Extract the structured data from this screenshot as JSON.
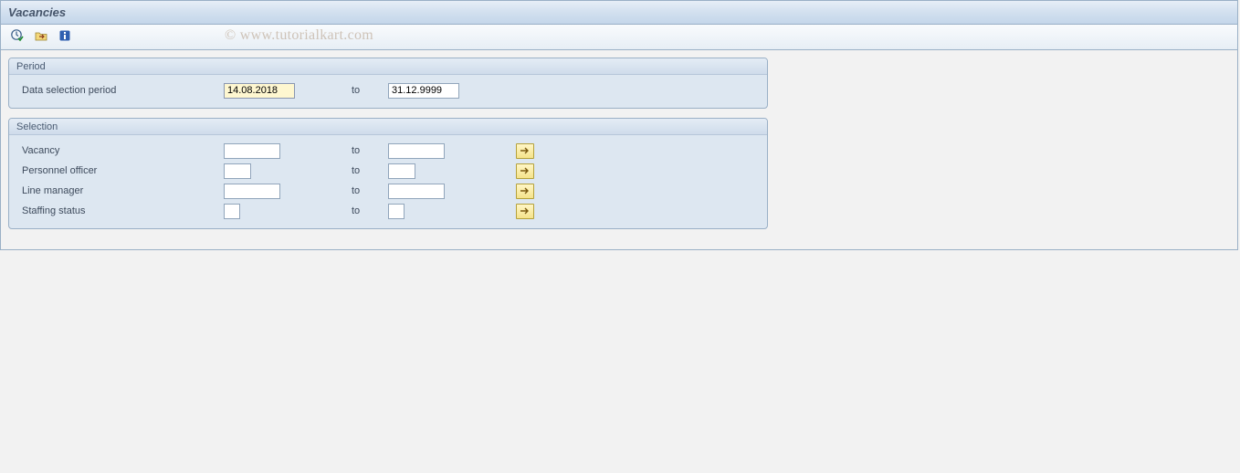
{
  "window": {
    "title": "Vacancies"
  },
  "watermark": "© www.tutorialkart.com",
  "groups": {
    "period": {
      "title": "Period",
      "row": {
        "label": "Data selection period",
        "from": "14.08.2018",
        "to_label": "to",
        "to": "31.12.9999"
      }
    },
    "selection": {
      "title": "Selection",
      "to_label": "to",
      "rows": [
        {
          "label": "Vacancy",
          "from": "",
          "to": ""
        },
        {
          "label": "Personnel officer",
          "from": "",
          "to": ""
        },
        {
          "label": "Line manager",
          "from": "",
          "to": ""
        },
        {
          "label": "Staffing status",
          "from": "",
          "to": ""
        }
      ]
    }
  }
}
